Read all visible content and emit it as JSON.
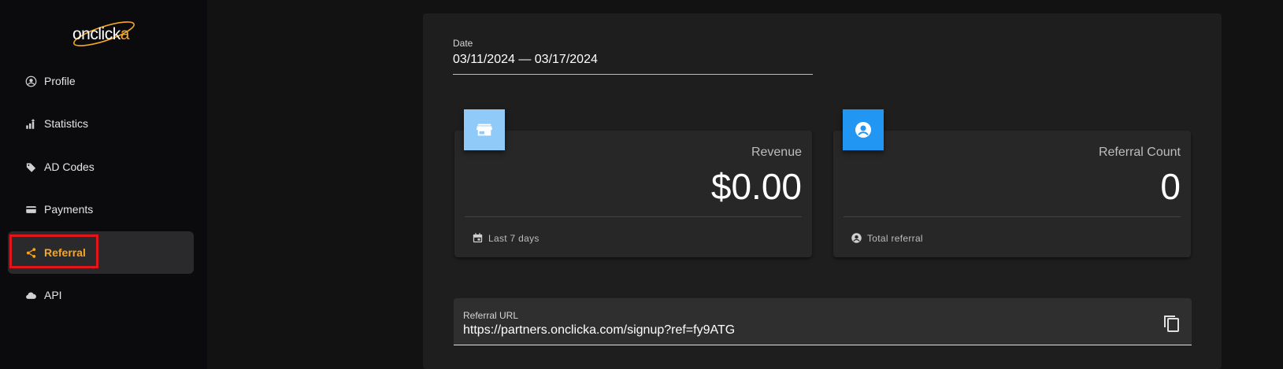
{
  "brand": {
    "logo_prefix": "onclick",
    "logo_suffix": "a",
    "accent": "#f5a623"
  },
  "sidebar": {
    "items": [
      {
        "label": "Profile",
        "icon": "account-circle-icon"
      },
      {
        "label": "Statistics",
        "icon": "chart-up-icon"
      },
      {
        "label": "AD Codes",
        "icon": "tag-icon"
      },
      {
        "label": "Payments",
        "icon": "card-icon"
      },
      {
        "label": "Referral",
        "icon": "share-icon",
        "active": true
      },
      {
        "label": "API",
        "icon": "cloud-icon"
      }
    ]
  },
  "filter": {
    "date_label": "Date",
    "date_value": "03/11/2024 — 03/17/2024"
  },
  "stats": {
    "revenue": {
      "label": "Revenue",
      "value": "$0.00",
      "footer": "Last 7 days",
      "icon": "store-icon",
      "color": "#90caf9"
    },
    "referral_count": {
      "label": "Referral Count",
      "value": "0",
      "footer": "Total referral",
      "icon": "account-circle-icon",
      "color": "#2196f3"
    }
  },
  "referral_url": {
    "label": "Referral URL",
    "value": "https://partners.onclicka.com/signup?ref=fy9ATG"
  }
}
